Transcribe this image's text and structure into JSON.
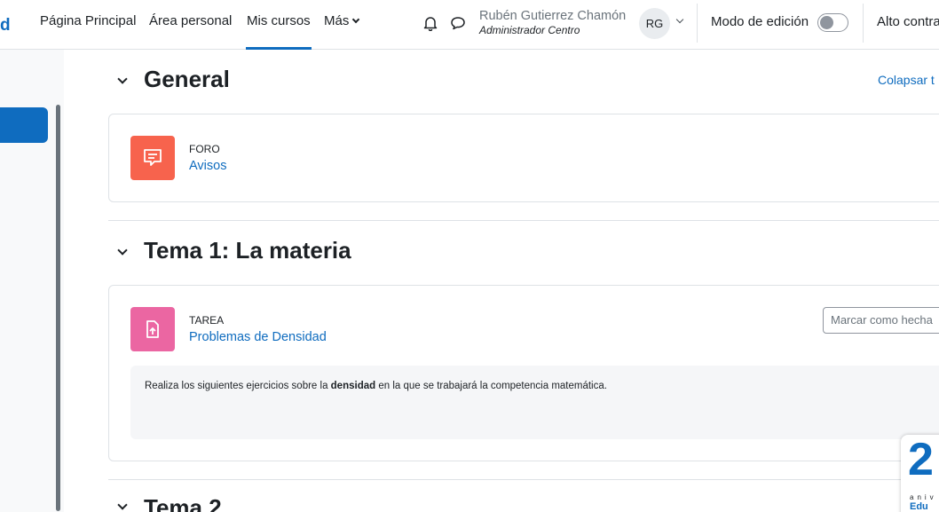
{
  "navbar": {
    "brand": "d",
    "links": {
      "home": "Página Principal",
      "dashboard": "Área personal",
      "mycourses": "Mis cursos",
      "more": "Más"
    },
    "user": {
      "name": "Rubén Gutierrez Chamón",
      "role": "Administrador Centro",
      "initials": "RG"
    },
    "edit_mode": {
      "label": "Modo de edición",
      "enabled": false
    },
    "contrast_label": "Alto contra"
  },
  "course": {
    "collapse_label": "Colapsar t",
    "sections": [
      {
        "title": "General",
        "activities": [
          {
            "type": "FORO",
            "name": "Avisos",
            "icon": "forum-icon"
          }
        ]
      },
      {
        "title": "Tema 1: La materia",
        "activities": [
          {
            "type": "TAREA",
            "name": "Problemas de Densidad",
            "icon": "assignment-icon",
            "completion_label": "Marcar como hecha",
            "description": {
              "before": "Realiza los siguientes ejercicios sobre la ",
              "bold": "densidad",
              "after": " en la que se trabajará la competencia matemática."
            }
          }
        ]
      },
      {
        "title": "Tema 2"
      }
    ]
  },
  "badge": {
    "number": "2",
    "sub": "aniv",
    "sub2": "Edu"
  },
  "colors": {
    "primary": "#0f6cbf",
    "forum": "#f7634d",
    "assignment": "#eb66a2"
  }
}
